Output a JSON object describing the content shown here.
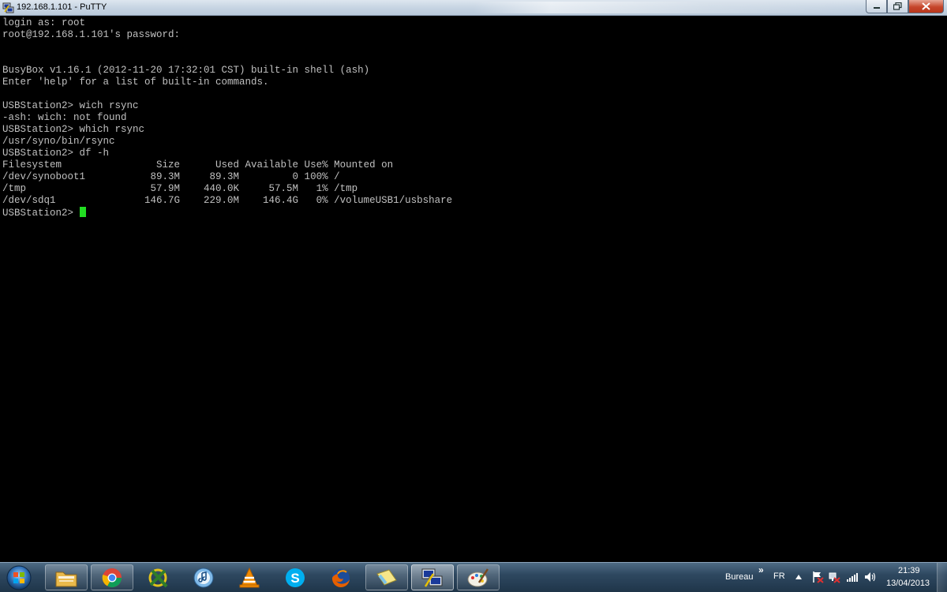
{
  "window": {
    "title": "192.168.1.101 - PuTTY",
    "buttons": {
      "minimize": "minimize-icon",
      "maximize": "restore-icon",
      "close": "close-icon"
    }
  },
  "terminal": {
    "lines": [
      "login as: root",
      "root@192.168.1.101's password:",
      "",
      "",
      "BusyBox v1.16.1 (2012-11-20 17:32:01 CST) built-in shell (ash)",
      "Enter 'help' for a list of built-in commands.",
      "",
      "USBStation2> wich rsync",
      "-ash: wich: not found",
      "USBStation2> which rsync",
      "/usr/syno/bin/rsync",
      "USBStation2> df -h",
      "Filesystem                Size      Used Available Use% Mounted on",
      "/dev/synoboot1           89.3M     89.3M         0 100% /",
      "/tmp                     57.9M    440.0K     57.5M   1% /tmp",
      "/dev/sdq1               146.7G    229.0M    146.4G   0% /volumeUSB1/usbshare"
    ],
    "prompt": "USBStation2> ",
    "cursor_color": "#22dd22",
    "text_color": "#c0c0c0",
    "background": "#000000"
  },
  "taskbar": {
    "items": [
      {
        "name": "explorer",
        "icon": "folder-icon"
      },
      {
        "name": "chrome",
        "icon": "chrome-icon"
      },
      {
        "name": "app-x",
        "icon": "x-logo-icon"
      },
      {
        "name": "itunes",
        "icon": "itunes-icon"
      },
      {
        "name": "vlc",
        "icon": "vlc-icon"
      },
      {
        "name": "skype",
        "icon": "skype-icon"
      },
      {
        "name": "firefox",
        "icon": "firefox-icon"
      },
      {
        "name": "notes",
        "icon": "notes-icon"
      },
      {
        "name": "putty",
        "icon": "putty-icon"
      },
      {
        "name": "paint",
        "icon": "paint-icon"
      }
    ],
    "toolbar_label": "Bureau",
    "toolbar_chevron": "»",
    "language": "FR",
    "clock_time": "21:39",
    "clock_date": "13/04/2013"
  }
}
